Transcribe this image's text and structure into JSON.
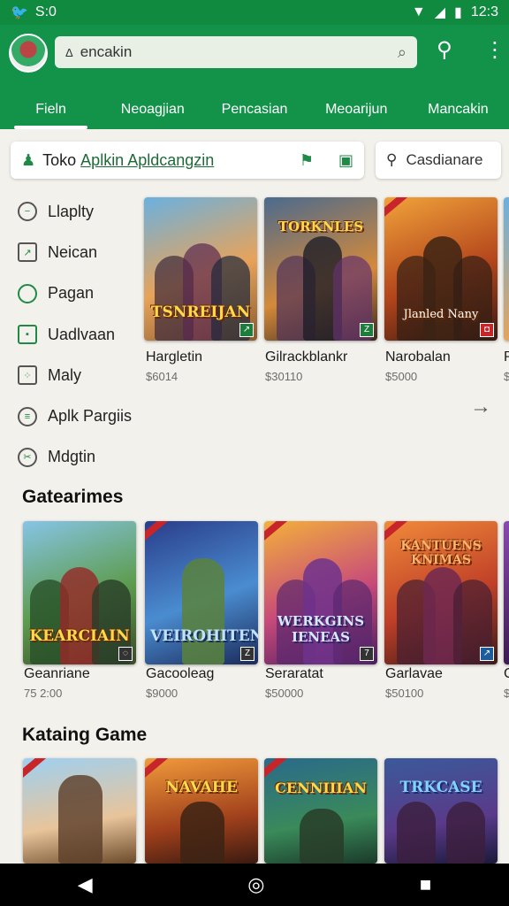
{
  "status_bar": {
    "left_text": "S:0",
    "time": "12:3"
  },
  "search": {
    "prefix": "Δ",
    "value": "encakin"
  },
  "tabs": [
    "Fieln",
    "Neoagjian",
    "Pencasian",
    "Meoarijun",
    "Mancakin"
  ],
  "store": {
    "prefix": "Toko",
    "link": "Aplkin Apldcangzin",
    "side_search_placeholder": "Casdianare"
  },
  "categories": [
    {
      "label": "Llaplty",
      "icon": "minus-circle-icon"
    },
    {
      "label": "Neican",
      "icon": "chart-icon"
    },
    {
      "label": "Pagan",
      "icon": "circle-icon"
    },
    {
      "label": "Uadlvaan",
      "icon": "calendar-icon"
    },
    {
      "label": "Maly",
      "icon": "grid-icon"
    },
    {
      "label": "Aplk Pargiis",
      "icon": "menu-circle-icon"
    },
    {
      "label": "Mdgtin",
      "icon": "scissors-icon"
    }
  ],
  "rows": [
    {
      "title": "",
      "items": [
        {
          "title": "Hargletin",
          "price": "$6014",
          "logo": "TSNREIJAN"
        },
        {
          "title": "Gilrackblankr",
          "price": "$30110",
          "logo": "TORKNLES"
        },
        {
          "title": "Narobalan",
          "price": "$5000",
          "logo": "Jlanled Nany"
        },
        {
          "title": "P",
          "price": "$",
          "logo": ""
        }
      ]
    },
    {
      "title": "Gatearimes",
      "items": [
        {
          "title": "Geanriane",
          "price": "75 2:00",
          "logo": "KEARCIAIN"
        },
        {
          "title": "Gacooleag",
          "price": "$9000",
          "logo": "VEIROHITEN"
        },
        {
          "title": "Seraratat",
          "price": "$50000",
          "logo": "WERKGINS IENEAS"
        },
        {
          "title": "Garlavae",
          "price": "$50100",
          "logo": "KANTUENS KNIMAS"
        },
        {
          "title": "C",
          "price": "$",
          "logo": ""
        }
      ]
    },
    {
      "title": "Kataing Game",
      "items": [
        {
          "title": "",
          "price": "",
          "logo": ""
        },
        {
          "title": "",
          "price": "",
          "logo": "NAVAHE"
        },
        {
          "title": "",
          "price": "",
          "logo": "CENNIIIAN"
        },
        {
          "title": "",
          "price": "",
          "logo": "TRKCASE"
        }
      ]
    }
  ],
  "colors": {
    "header": "#13934a",
    "status": "#0f8a3f",
    "background": "#f3f1ec"
  }
}
